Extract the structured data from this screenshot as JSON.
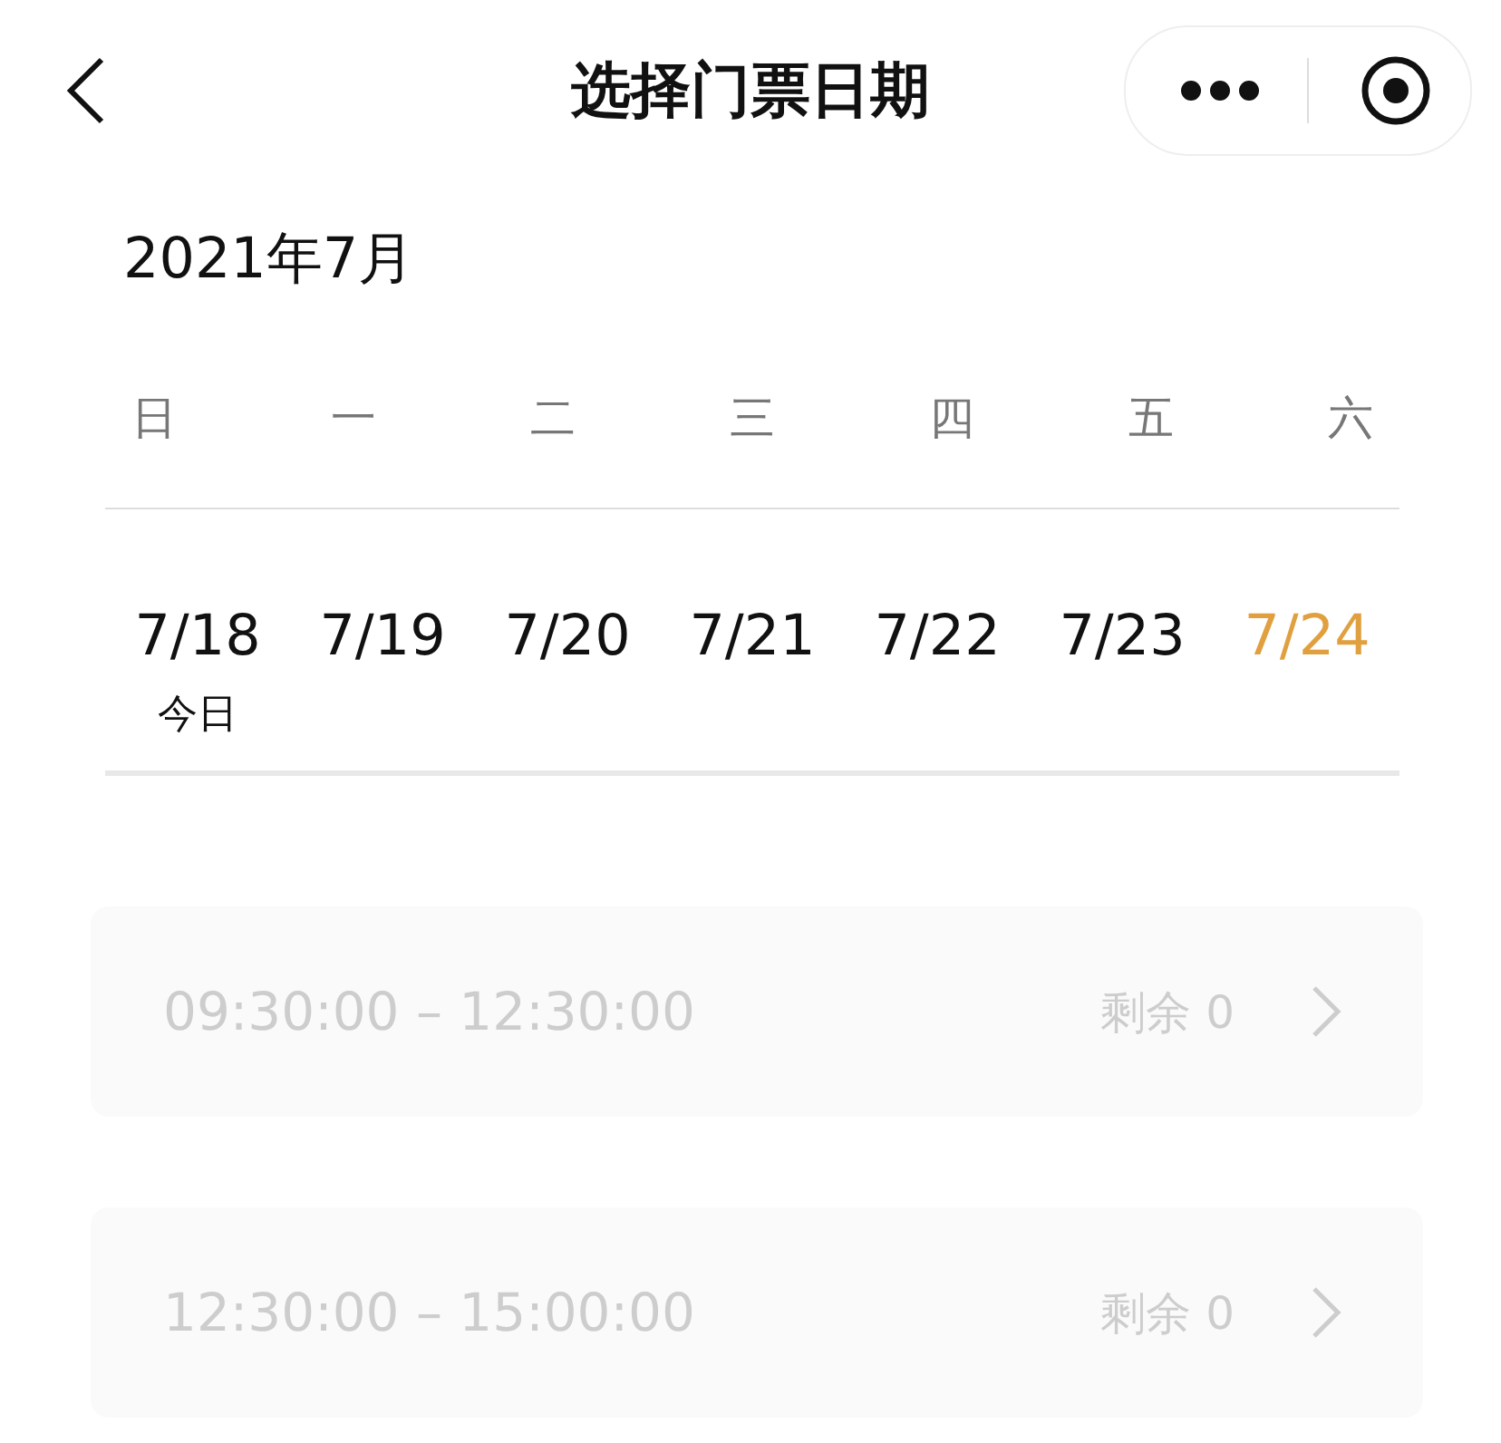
{
  "nav": {
    "title": "选择门票日期"
  },
  "month": "2021年7月",
  "weekdays": [
    "日",
    "一",
    "二",
    "三",
    "四",
    "五",
    "六"
  ],
  "dates": [
    {
      "label": "7/18",
      "note": "今日",
      "selected": false
    },
    {
      "label": "7/19",
      "selected": false
    },
    {
      "label": "7/20",
      "selected": false
    },
    {
      "label": "7/21",
      "selected": false
    },
    {
      "label": "7/22",
      "selected": false
    },
    {
      "label": "7/23",
      "selected": false
    },
    {
      "label": "7/24",
      "selected": true
    }
  ],
  "slots": [
    {
      "time": "09:30:00 – 12:30:00",
      "remaining": "剩余 0",
      "disabled": true
    },
    {
      "time": "12:30:00 – 15:00:00",
      "remaining": "剩余 0",
      "disabled": true
    }
  ]
}
